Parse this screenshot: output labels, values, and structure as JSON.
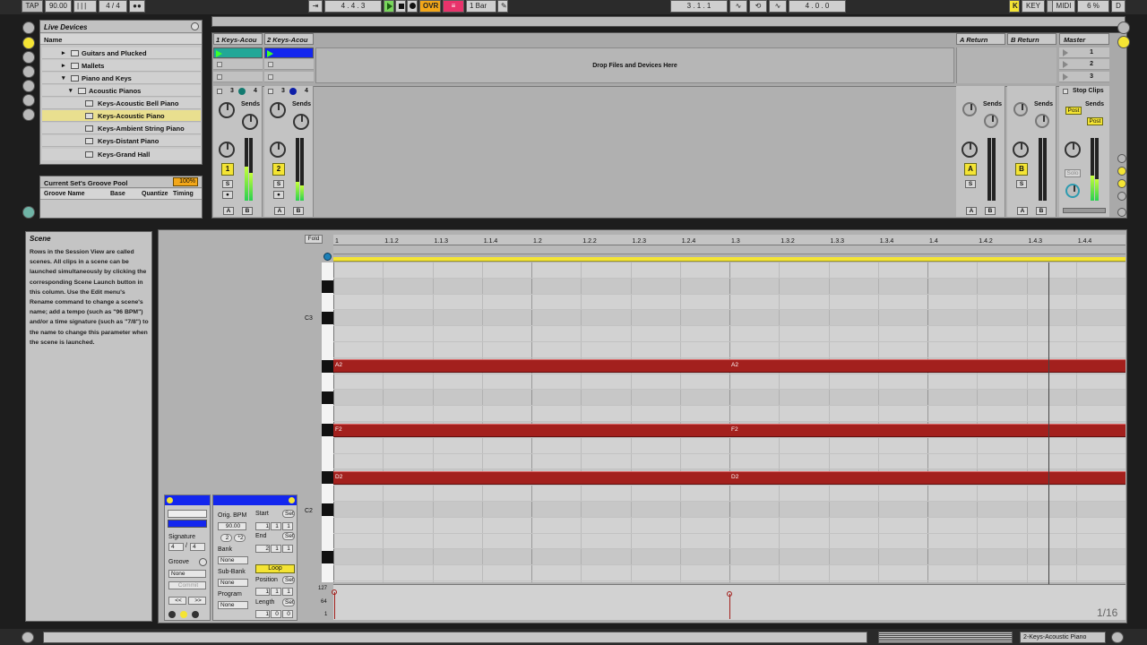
{
  "transport": {
    "tap": "TAP",
    "tempo": "90.00",
    "signature": "4 / 4",
    "position": "4 . 4 . 3",
    "ovr": "OVR",
    "quantize": "1 Bar",
    "loop_start": "3 . 1 . 1",
    "loop_length": "4 . 0 . 0",
    "key": "KEY",
    "midi": "MIDI",
    "cpu": "6 %",
    "d": "D"
  },
  "browser": {
    "title": "Live Devices",
    "column": "Name",
    "items": [
      {
        "label": "Guitars and Plucked"
      },
      {
        "label": "Mallets"
      },
      {
        "label": "Piano and Keys"
      },
      {
        "label": "Acoustic Pianos"
      },
      {
        "label": "Keys-Acoustic Bell Piano"
      },
      {
        "label": "Keys-Acoustic Piano"
      },
      {
        "label": "Keys-Ambient String Piano"
      },
      {
        "label": "Keys-Distant Piano"
      },
      {
        "label": "Keys-Grand Hall"
      }
    ]
  },
  "groove": {
    "title": "Current Set's Groove Pool",
    "percent": "100%",
    "cols": [
      "Groove Name",
      "Base",
      "Quantize",
      "Timing"
    ]
  },
  "session": {
    "tracks": [
      {
        "name": "1 Keys-Acou",
        "color": "#22b0a0",
        "track_num": "1"
      },
      {
        "name": "2 Keys-Acou",
        "color": "#1326ee",
        "track_num": "2"
      }
    ],
    "drop_hint": "Drop Files and Devices Here",
    "returns": [
      {
        "name": "A Return",
        "letter": "A"
      },
      {
        "name": "B Return",
        "letter": "B"
      }
    ],
    "master": "Master",
    "scenes": [
      "1",
      "2",
      "3"
    ],
    "stop_clips": "Stop Clips",
    "sends": "Sends",
    "post": "Post",
    "solo": "Solo",
    "s": "S",
    "a": "A",
    "b": "B",
    "three": "3",
    "four": "4"
  },
  "info": {
    "title": "Scene",
    "text": "Rows in the Session View are called scenes. All clips in a scene can be launched simultaneously by clicking the corresponding Scene Launch button in this column. Use the Edit menu's Rename command to change a scene's name; add a tempo (such as \"96 BPM\") and/or a time signature (such as \"7/8\") to the name to change this parameter when the scene is launched."
  },
  "clip": {
    "signature_label": "Signature",
    "sig_num": "4",
    "sig_den": "4",
    "groove_label": "Groove",
    "groove_value": "None",
    "commit": "Commit",
    "orig_bpm_label": "Orig. BPM",
    "orig_bpm": "90.00",
    "half": "2",
    "double": "*2",
    "bank_label": "Bank",
    "bank": "None",
    "subbank_label": "Sub-Bank",
    "subbank": "None",
    "program_label": "Program",
    "program": "None",
    "start_label": "Start",
    "start": [
      "1",
      "1",
      "1"
    ],
    "end_label": "End",
    "end": [
      "2",
      "1",
      "1"
    ],
    "loop": "Loop",
    "position_label": "Position",
    "position": [
      "1",
      "1",
      "1"
    ],
    "length_label": "Length",
    "length": [
      "1",
      "0",
      "0"
    ],
    "set": "Set",
    "nav_prev": "<<",
    "nav_next": ">>"
  },
  "piano_roll": {
    "fold": "Fold",
    "ruler": [
      "1",
      "1.1.2",
      "1.1.3",
      "1.1.4",
      "1.2",
      "1.2.2",
      "1.2.3",
      "1.2.4",
      "1.3",
      "1.3.2",
      "1.3.3",
      "1.3.4",
      "1.4",
      "1.4.2",
      "1.4.3",
      "1.4.4"
    ],
    "keys": [
      "C3",
      "C2"
    ],
    "notes": [
      {
        "pitch": "A2",
        "labels": [
          "A2",
          "A2"
        ]
      },
      {
        "pitch": "F2",
        "labels": [
          "F2",
          "F2"
        ]
      },
      {
        "pitch": "D2",
        "labels": [
          "D2",
          "D2"
        ]
      }
    ],
    "velocity": [
      "127",
      "64",
      "1"
    ],
    "grid": "1/16"
  },
  "status": {
    "track": "2-Keys-Acoustic Piano"
  }
}
